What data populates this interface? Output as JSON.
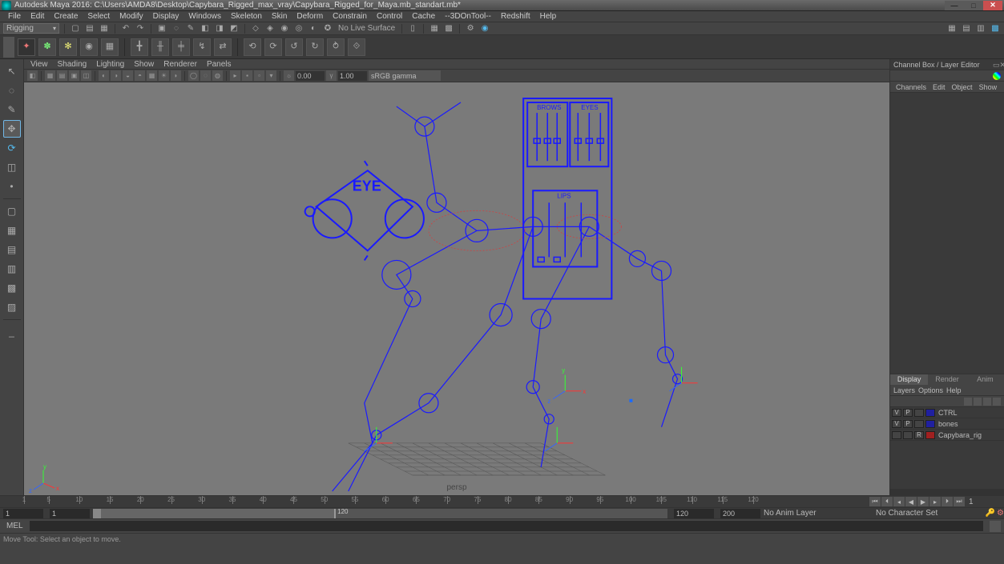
{
  "titlebar": {
    "title": "Autodesk Maya 2016: C:\\Users\\AMDA8\\Desktop\\Capybara_Rigged_max_vray\\Capybara_Rigged_for_Maya.mb_standart.mb*"
  },
  "menubar": [
    "File",
    "Edit",
    "Create",
    "Select",
    "Modify",
    "Display",
    "Windows",
    "Skeleton",
    "Skin",
    "Deform",
    "Constrain",
    "Control",
    "Cache",
    "--3DOnTool--",
    "Redshift",
    "Help"
  ],
  "shelfA": {
    "workspace": "Rigging",
    "noLiveSurface": "No Live Surface"
  },
  "viewport_menu": [
    "View",
    "Shading",
    "Lighting",
    "Show",
    "Renderer",
    "Panels"
  ],
  "viewport_toolbar": {
    "val1": "0.00",
    "val2": "1.00",
    "colorspace": "sRGB gamma"
  },
  "viewport": {
    "cameraLabel": "persp",
    "rig_labels": {
      "eye": "EYE",
      "brows": "BROWS",
      "eyes": "EYES",
      "lips": "LIPS"
    }
  },
  "channelbox": {
    "title": "Channel Box / Layer Editor",
    "menus": [
      "Channels",
      "Edit",
      "Object",
      "Show"
    ],
    "tabs": [
      "Display",
      "Render",
      "Anim"
    ],
    "options": [
      "Layers",
      "Options",
      "Help"
    ],
    "layers": [
      {
        "vis": "V",
        "play": "P",
        "disp": "",
        "color": "#2020a0",
        "name": "CTRL"
      },
      {
        "vis": "V",
        "play": "P",
        "disp": "",
        "color": "#2020a0",
        "name": "bones"
      },
      {
        "vis": "",
        "play": "",
        "disp": "R",
        "color": "#a02020",
        "name": "Capybara_rig"
      }
    ]
  },
  "timeline": {
    "ticks_major": [
      1,
      5,
      10,
      15,
      20,
      25,
      30,
      35,
      40,
      45,
      50,
      55,
      60,
      65,
      70,
      75,
      80,
      85,
      90,
      95,
      100,
      105,
      110,
      115,
      120
    ],
    "current_frame": "1",
    "range_start": "1",
    "range_end_vis": "120",
    "range_min": "1",
    "range_max": "120",
    "range_outer_min": "1",
    "range_outer_max": "200",
    "anim_layer": "No Anim Layer",
    "char_set": "No Character Set"
  },
  "cmd": {
    "label": "MEL"
  },
  "status": "Move Tool: Select an object to move."
}
